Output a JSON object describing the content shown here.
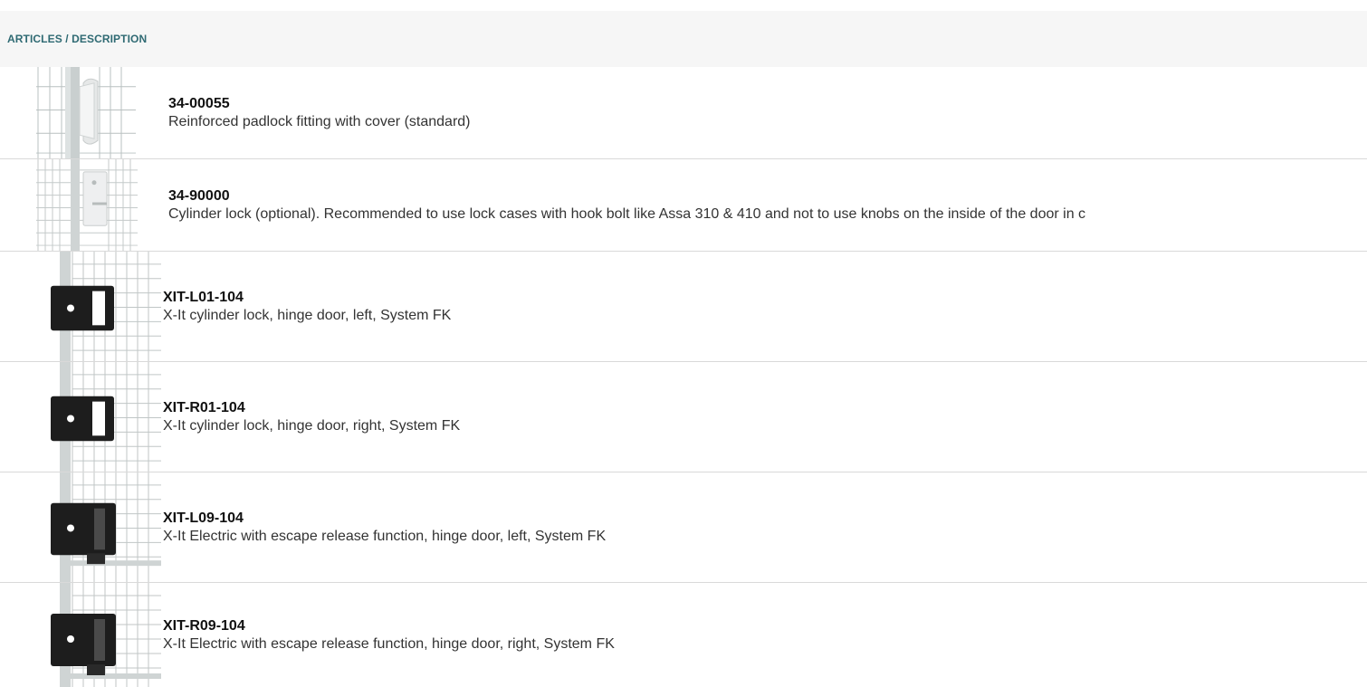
{
  "header": {
    "title": "ARTICLES / DESCRIPTION"
  },
  "articles": [
    {
      "code": "34-00055",
      "description": "Reinforced padlock fitting with cover (standard)",
      "image": "padlock-fitting-icon"
    },
    {
      "code": "34-90000",
      "description": "Cylinder lock (optional). Recommended to use lock cases with hook bolt like Assa 310 & 410 and not to use knobs on the inside of the door in c",
      "image": "cylinder-lock-icon"
    },
    {
      "code": "XIT-L01-104",
      "description": "X-It cylinder lock, hinge door, left, System FK",
      "image": "xit-lock-icon"
    },
    {
      "code": "XIT-R01-104",
      "description": "X-It cylinder lock, hinge door, right, System FK",
      "image": "xit-lock-icon"
    },
    {
      "code": "XIT-L09-104",
      "description": "X-It Electric with escape release function, hinge door, left, System FK",
      "image": "xit-electric-lock-icon"
    },
    {
      "code": "XIT-R09-104",
      "description": "X-It Electric with escape release function, hinge door, right, System FK",
      "image": "xit-electric-lock-icon"
    }
  ]
}
